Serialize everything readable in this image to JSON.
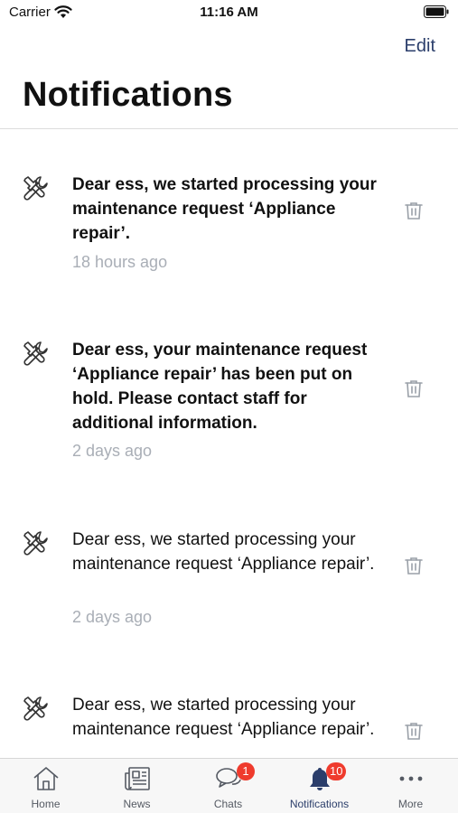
{
  "status_bar": {
    "carrier": "Carrier",
    "time": "11:16 AM"
  },
  "header": {
    "edit_label": "Edit",
    "title": "Notifications"
  },
  "notifications": [
    {
      "icon": "tools-icon",
      "text": "Dear ess, we started processing your maintenance request ‘Appliance repair’.",
      "time": "18 hours ago",
      "unread": true
    },
    {
      "icon": "tools-icon",
      "text": "Dear ess, your maintenance request ‘Appliance repair’ has been put on hold. Please contact staff for additional information.",
      "time": "2 days ago",
      "unread": true
    },
    {
      "icon": "tools-icon",
      "text": "Dear ess, we started processing your maintenance request ‘Appliance repair’.",
      "time": "2 days ago",
      "unread": false
    },
    {
      "icon": "tools-icon",
      "text": "Dear ess, we started processing your maintenance request ‘Appliance repair’.",
      "time": "",
      "unread": false
    }
  ],
  "tab_bar": {
    "tabs": [
      {
        "label": "Home",
        "icon": "home-icon"
      },
      {
        "label": "News",
        "icon": "newspaper-icon"
      },
      {
        "label": "Chats",
        "icon": "chat-icon",
        "badge": "1"
      },
      {
        "label": "Notifications",
        "icon": "bell-icon",
        "badge": "10",
        "active": true
      },
      {
        "label": "More",
        "icon": "more-icon"
      }
    ]
  },
  "colors": {
    "accent": "#2b3e6b",
    "badge": "#ef3b2d",
    "timestamp": "#a9aeb6"
  }
}
